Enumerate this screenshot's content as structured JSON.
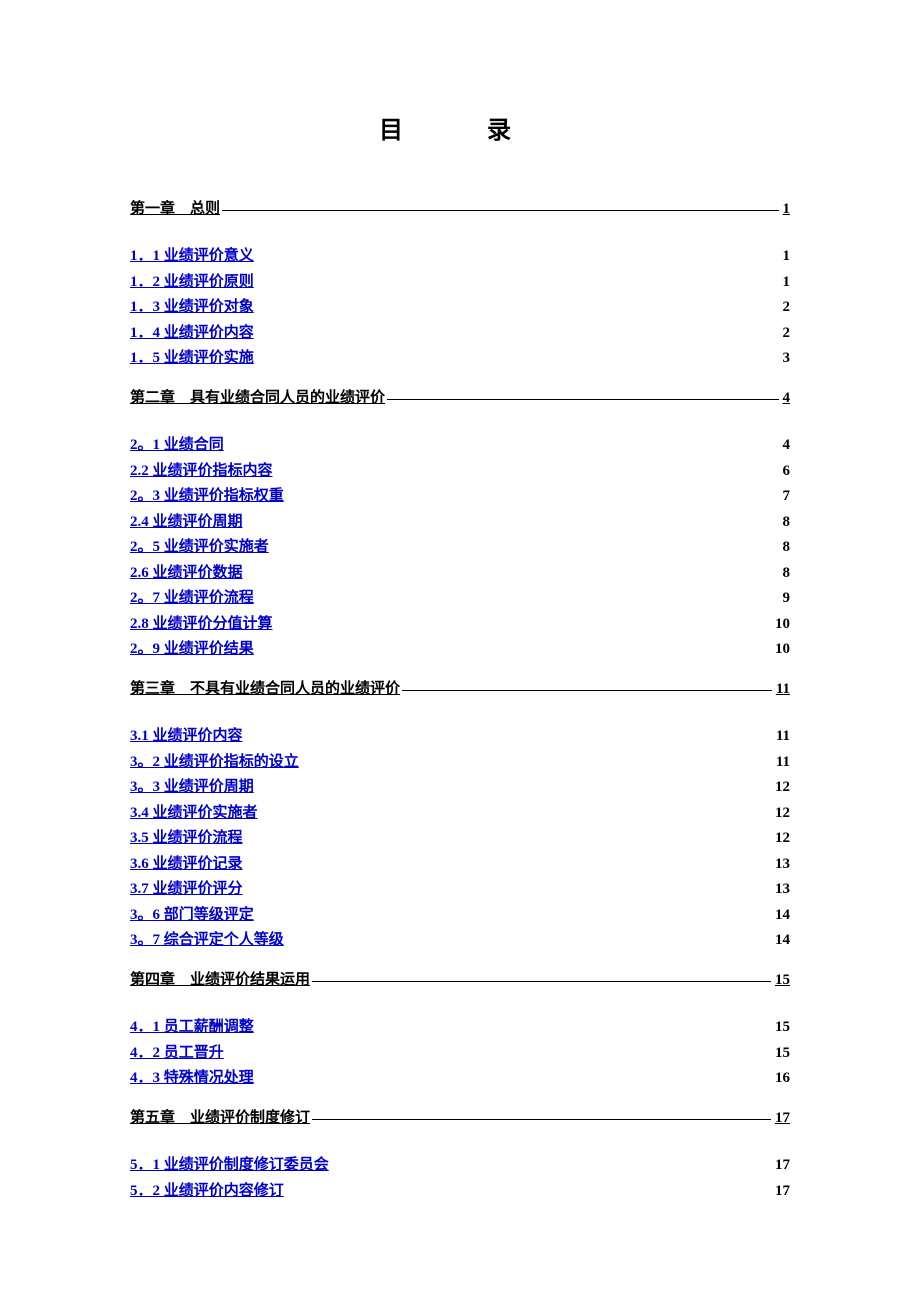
{
  "title": "目　录",
  "toc": [
    {
      "chapter": {
        "label": "第一章　总则",
        "page": "1"
      },
      "sections": [
        {
          "label": "1．1 业绩评价意义",
          "page": "1"
        },
        {
          "label": "1．2 业绩评价原则",
          "page": "1"
        },
        {
          "label": "1．3 业绩评价对象",
          "page": "2"
        },
        {
          "label": "1．4 业绩评价内容",
          "page": "2"
        },
        {
          "label": "1．5 业绩评价实施",
          "page": "3"
        }
      ]
    },
    {
      "chapter": {
        "label": "第二章　具有业绩合同人员的业绩评价",
        "page": "4"
      },
      "sections": [
        {
          "label": "2。1 业绩合同",
          "page": "4"
        },
        {
          "label": "2.2 业绩评价指标内容",
          "page": "6"
        },
        {
          "label": "2。3 业绩评价指标权重",
          "page": "7"
        },
        {
          "label": "2.4 业绩评价周期",
          "page": "8"
        },
        {
          "label": "2。5 业绩评价实施者",
          "page": "8"
        },
        {
          "label": "2.6 业绩评价数据",
          "page": "8"
        },
        {
          "label": "2。7 业绩评价流程",
          "page": "9"
        },
        {
          "label": "2.8 业绩评价分值计算",
          "page": "10"
        },
        {
          "label": "2。9 业绩评价结果",
          "page": "10"
        }
      ]
    },
    {
      "chapter": {
        "label": "第三章　不具有业绩合同人员的业绩评价",
        "page": "11"
      },
      "sections": [
        {
          "label": "3.1 业绩评价内容",
          "page": "11"
        },
        {
          "label": "3。2 业绩评价指标的设立",
          "page": "11"
        },
        {
          "label": "3。3 业绩评价周期",
          "page": "12"
        },
        {
          "label": "3.4 业绩评价实施者",
          "page": "12"
        },
        {
          "label": "3.5 业绩评价流程",
          "page": "12"
        },
        {
          "label": "3.6 业绩评价记录",
          "page": "13"
        },
        {
          "label": "3.7 业绩评价评分",
          "page": "13"
        },
        {
          "label": "3。6 部门等级评定",
          "page": "14"
        },
        {
          "label": "3。7 综合评定个人等级",
          "page": "14"
        }
      ]
    },
    {
      "chapter": {
        "label": "第四章　业绩评价结果运用",
        "page": "15"
      },
      "sections": [
        {
          "label": "4．1 员工薪酬调整",
          "page": "15"
        },
        {
          "label": "4．2 员工晋升",
          "page": "15"
        },
        {
          "label": "4．3 特殊情况处理",
          "page": "16"
        }
      ]
    },
    {
      "chapter": {
        "label": "第五章　业绩评价制度修订",
        "page": "17"
      },
      "sections": [
        {
          "label": "5．1 业绩评价制度修订委员会",
          "page": "17"
        },
        {
          "label": "5．2 业绩评价内容修订",
          "page": "17"
        }
      ]
    }
  ]
}
